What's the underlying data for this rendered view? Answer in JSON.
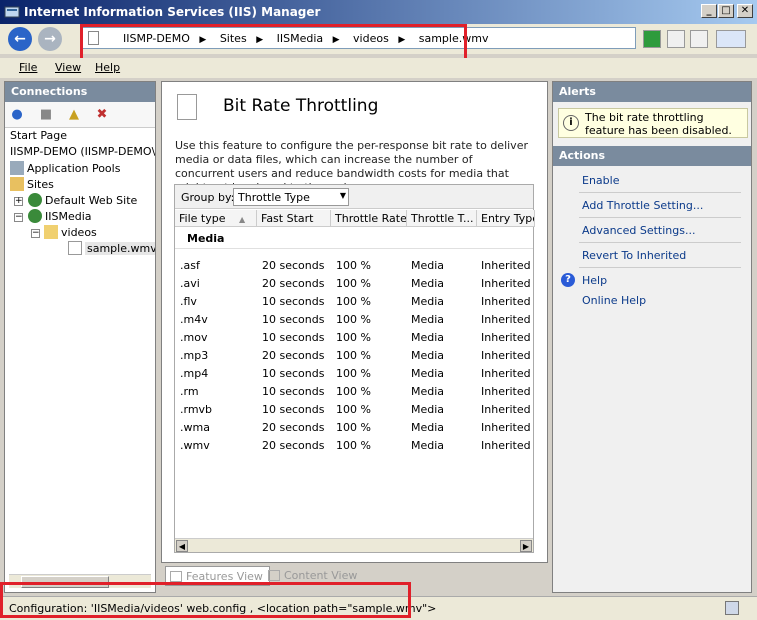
{
  "window": {
    "title": "Internet Information Services (IIS) Manager",
    "minimize_glyph": "_",
    "maximize_glyph": "□",
    "close_glyph": "✕"
  },
  "nav": {
    "back_glyph": "←",
    "forward_glyph": "→",
    "breadcrumbs": [
      "IISMP-DEMO",
      "Sites",
      "IISMedia",
      "videos",
      "sample.wmv"
    ],
    "separator": "▶"
  },
  "toolbar_icons": [
    "refresh-icon",
    "stop-icon",
    "home-icon",
    "help-dropdown-icon"
  ],
  "menu": {
    "file": "File",
    "view": "View",
    "help": "Help"
  },
  "connections": {
    "header": "Connections",
    "tree": {
      "start_page": "Start Page",
      "server": "IISMP-DEMO (IISMP-DEMO\\Ac",
      "app_pools": "Application Pools",
      "sites": "Sites",
      "default_site": "Default Web Site",
      "iismedia": "IISMedia",
      "videos": "videos",
      "file": "sample.wmv"
    }
  },
  "feature": {
    "title": "Bit Rate Throttling",
    "description": "Use this feature to configure the per-response bit rate to deliver media or data files, which can increase the number of concurrent users and reduce bandwidth costs for media that might not be played to the end.",
    "group_by_label": "Group by:",
    "group_by_value": "Throttle Type",
    "columns": [
      "File type",
      "Fast Start",
      "Throttle Rate",
      "Throttle T...",
      "Entry Type"
    ],
    "group_name": "Media",
    "rows": [
      [
        ".asf",
        "20 seconds",
        "100 %",
        "Media",
        "Inherited"
      ],
      [
        ".avi",
        "20 seconds",
        "100 %",
        "Media",
        "Inherited"
      ],
      [
        ".flv",
        "10 seconds",
        "100 %",
        "Media",
        "Inherited"
      ],
      [
        ".m4v",
        "10 seconds",
        "100 %",
        "Media",
        "Inherited"
      ],
      [
        ".mov",
        "10 seconds",
        "100 %",
        "Media",
        "Inherited"
      ],
      [
        ".mp3",
        "20 seconds",
        "100 %",
        "Media",
        "Inherited"
      ],
      [
        ".mp4",
        "10 seconds",
        "100 %",
        "Media",
        "Inherited"
      ],
      [
        ".rm",
        "10 seconds",
        "100 %",
        "Media",
        "Inherited"
      ],
      [
        ".rmvb",
        "10 seconds",
        "100 %",
        "Media",
        "Inherited"
      ],
      [
        ".wma",
        "20 seconds",
        "100 %",
        "Media",
        "Inherited"
      ],
      [
        ".wmv",
        "20 seconds",
        "100 %",
        "Media",
        "Inherited"
      ]
    ]
  },
  "view_tabs": {
    "features": "Features View",
    "content": "Content View"
  },
  "alerts": {
    "header": "Alerts",
    "message": "The bit rate throttling feature has been disabled."
  },
  "actions": {
    "header": "Actions",
    "enable": "Enable",
    "add": "Add Throttle Setting...",
    "advanced": "Advanced Settings...",
    "revert": "Revert To Inherited",
    "help": "Help",
    "online_help": "Online Help"
  },
  "status": {
    "text": "Configuration: 'IISMedia/videos' web.config , <location path=\"sample.wmv\">"
  },
  "colors": {
    "highlight_box": "#e0202a",
    "panel_header": "#7a8b9e",
    "link": "#0b3a8a"
  }
}
